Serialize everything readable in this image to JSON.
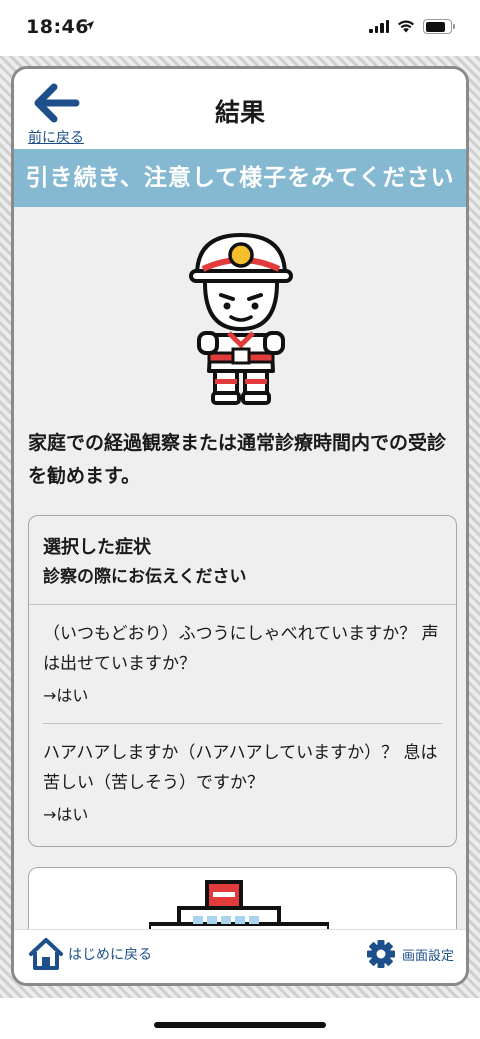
{
  "status_bar": {
    "time": "18:46",
    "icons": [
      "location-arrow-icon",
      "cellular-signal-icon",
      "wifi-icon",
      "battery-icon"
    ]
  },
  "header": {
    "back_label": "前に戻る",
    "back_icon": "arrow-left-icon",
    "title": "結果"
  },
  "banner": {
    "text": "引き続き、注意して様子をみてください",
    "background": "#85b8d1"
  },
  "main": {
    "illustration": "firefighter-mascot",
    "advice": "家庭での経過観察または通常診療時間内での受診を勧めます。",
    "symptoms": {
      "title": "選択した症状",
      "subtitle": "診察の際にお伝えください",
      "items": [
        {
          "question": "（いつもどおり）ふつうにしゃべれていますか？ 声は出せていますか？",
          "answer": "→はい"
        },
        {
          "question": "ハアハアしますか（ハアハアしていますか）？ 息は苦しい（苦しそう）ですか？",
          "answer": "→はい"
        }
      ]
    },
    "next_illustration": "hospital-building"
  },
  "footer": {
    "home_label": "はじめに戻る",
    "home_icon": "house-icon",
    "settings_label": "画面設定",
    "settings_icon": "gear-icon"
  },
  "colors": {
    "accent": "#1d4f8a",
    "banner": "#85b8d1",
    "helmet_red": "#e23b3b",
    "badge_yellow": "#f6c02b"
  }
}
